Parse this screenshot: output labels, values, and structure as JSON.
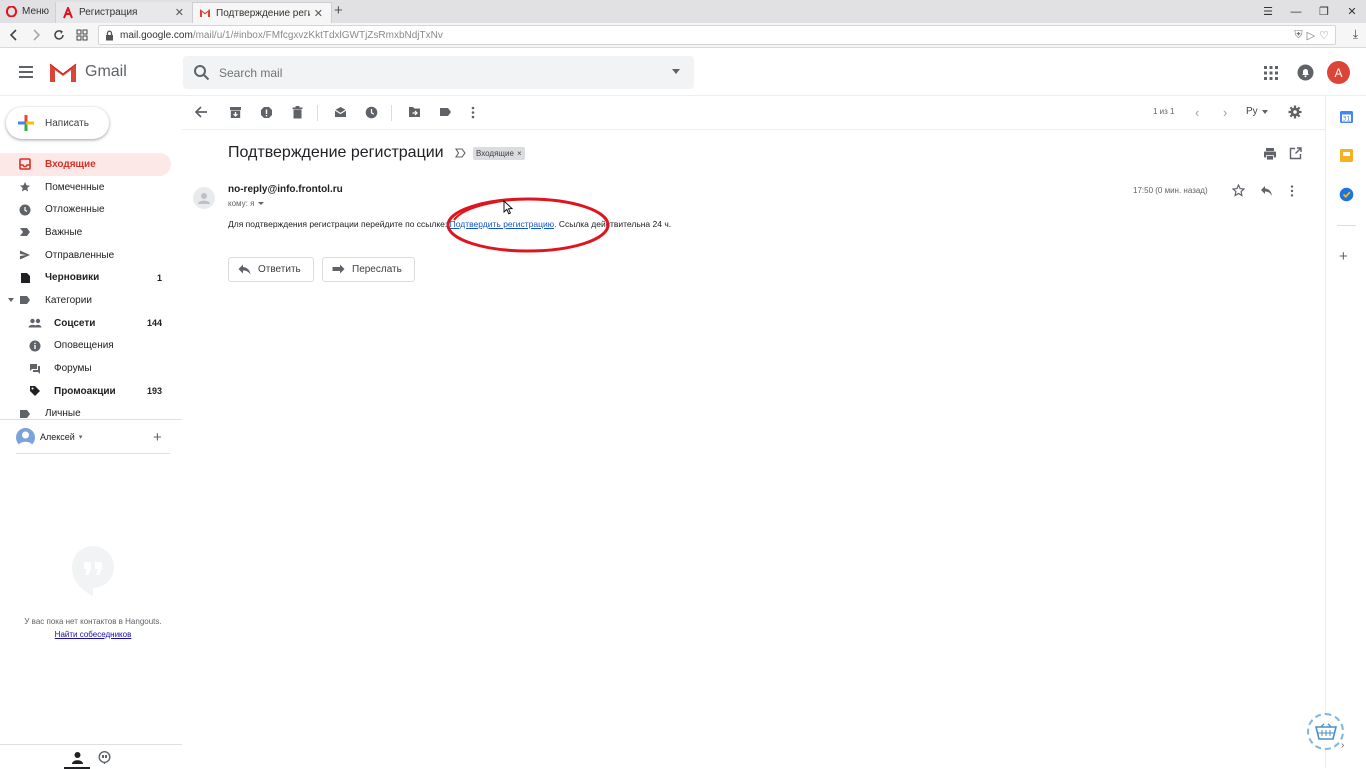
{
  "browser": {
    "menu_label": "Меню",
    "tabs": [
      {
        "title": "Регистрация",
        "active": false
      },
      {
        "title": "Подтверждение регистра",
        "active": true
      }
    ],
    "url_host": "mail.google.com",
    "url_path": "/mail/u/1/#inbox/FMfcgxvzKktTdxlGWTjZsRmxbNdjTxNv"
  },
  "gmail": {
    "brand": "Gmail",
    "search_placeholder": "Search mail",
    "avatar_letter": "A",
    "accent_red": "#db4437"
  },
  "sidebar": {
    "compose_label": "Написать",
    "items": [
      {
        "label": "Входящие",
        "icon": "inbox-icon",
        "count": "",
        "active": true
      },
      {
        "label": "Помеченные",
        "icon": "star-icon",
        "count": ""
      },
      {
        "label": "Отложенные",
        "icon": "clock-icon",
        "count": ""
      },
      {
        "label": "Важные",
        "icon": "important-icon",
        "count": ""
      },
      {
        "label": "Отправленные",
        "icon": "send-icon",
        "count": ""
      },
      {
        "label": "Черновики",
        "icon": "draft-icon",
        "count": "1",
        "bold": true
      },
      {
        "label": "Категории",
        "icon": "label-icon",
        "count": ""
      },
      {
        "label": "Соцсети",
        "icon": "people-icon",
        "count": "144",
        "bold": true,
        "sub": true
      },
      {
        "label": "Оповещения",
        "icon": "info-icon",
        "count": "",
        "sub": true
      },
      {
        "label": "Форумы",
        "icon": "forum-icon",
        "count": "",
        "sub": true
      },
      {
        "label": "Промоакции",
        "icon": "tag-icon",
        "count": "193",
        "bold": true,
        "sub": true
      },
      {
        "label": "Личные",
        "icon": "label-icon",
        "count": ""
      }
    ],
    "user_name": "Алексей",
    "hangouts_empty_text": "У вас пока нет контактов в Hangouts.",
    "hangouts_link": "Найти собеседников"
  },
  "toolbar": {
    "pager": "1 из 1",
    "lang": "Ру"
  },
  "message": {
    "subject": "Подтверждение регистрации",
    "label_chip": "Входящие",
    "sender": "no-reply@info.frontol.ru",
    "to_line": "кому: я",
    "time": "17:50 (0 мин. назад)",
    "body_before": "Для подтверждения регистрации перейдите по ссылке: ",
    "body_link": "Подтвердить регистрацию",
    "body_after": ". Ссылка действительна 24 ч.",
    "reply_label": "Ответить",
    "forward_label": "Переслать",
    "annotation_color": "#e0141e"
  }
}
